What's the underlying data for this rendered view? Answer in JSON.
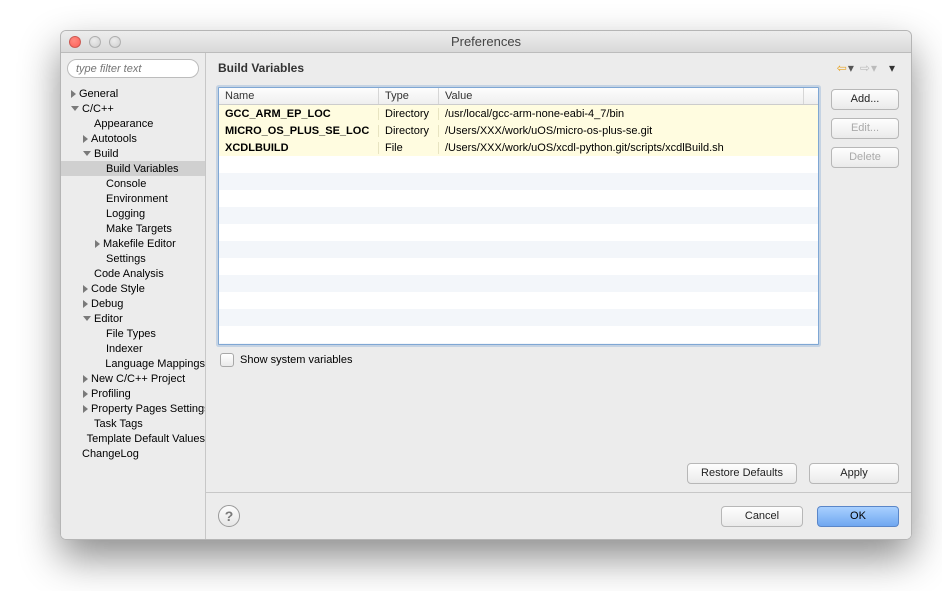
{
  "window": {
    "title": "Preferences"
  },
  "filter": {
    "placeholder": "type filter text"
  },
  "tree": {
    "general": "General",
    "ccpp": "C/C++",
    "appearance": "Appearance",
    "autotools": "Autotools",
    "build": "Build",
    "build_variables": "Build Variables",
    "console": "Console",
    "environment": "Environment",
    "logging": "Logging",
    "make_targets": "Make Targets",
    "makefile_editor": "Makefile Editor",
    "settings": "Settings",
    "code_analysis": "Code Analysis",
    "code_style": "Code Style",
    "debug": "Debug",
    "editor": "Editor",
    "file_types": "File Types",
    "indexer": "Indexer",
    "language_mapping": "Language Mappings",
    "new_project": "New C/C++ Project",
    "profiling": "Profiling",
    "property_pages": "Property Pages Settings",
    "task_tags": "Task Tags",
    "template_default": "Template Default Values",
    "changelog": "ChangeLog"
  },
  "main": {
    "heading": "Build Variables",
    "columns": {
      "name": "Name",
      "type": "Type",
      "value": "Value"
    },
    "rows": [
      {
        "name": "GCC_ARM_EP_LOC",
        "type": "Directory",
        "value": "/usr/local/gcc-arm-none-eabi-4_7/bin"
      },
      {
        "name": "MICRO_OS_PLUS_SE_LOC",
        "type": "Directory",
        "value": "/Users/XXX/work/uOS/micro-os-plus-se.git"
      },
      {
        "name": "XCDLBUILD",
        "type": "File",
        "value": "/Users/XXX/work/uOS/xcdl-python.git/scripts/xcdlBuild.sh"
      }
    ],
    "show_system": "Show system variables"
  },
  "buttons": {
    "add": "Add...",
    "edit": "Edit...",
    "delete": "Delete",
    "restore": "Restore Defaults",
    "apply": "Apply",
    "cancel": "Cancel",
    "ok": "OK"
  }
}
